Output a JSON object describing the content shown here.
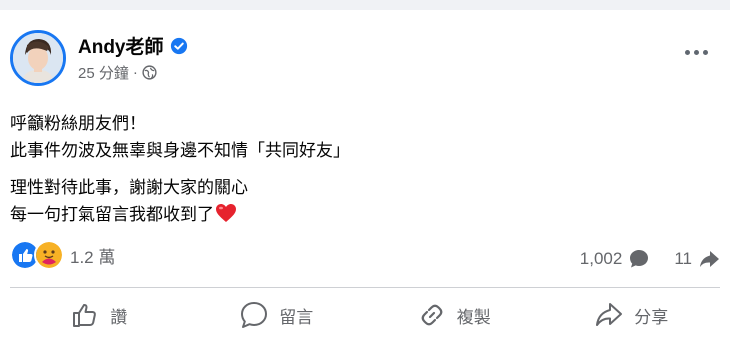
{
  "post": {
    "author": "Andy老師",
    "time": "25 分鐘",
    "separator": "·",
    "lines": [
      "呼籲粉絲朋友們！",
      "此事件勿波及無辜與身邊不知情「共同好友」",
      "理性對待此事，謝謝大家的關心",
      "每一句打氣留言我都收到了"
    ],
    "heart_emoji": "❤️"
  },
  "reactions": {
    "count": "1.2 萬",
    "icons": [
      "like-icon",
      "care-icon"
    ],
    "like_color": "#1877f2",
    "care_color": "#f7b125"
  },
  "stats": {
    "comments": "1,002",
    "shares": "11"
  },
  "actions": {
    "like": "讚",
    "comment": "留言",
    "copy": "複製",
    "share": "分享"
  },
  "colors": {
    "verified": "#1877f2",
    "secondary_text": "#65676b"
  }
}
